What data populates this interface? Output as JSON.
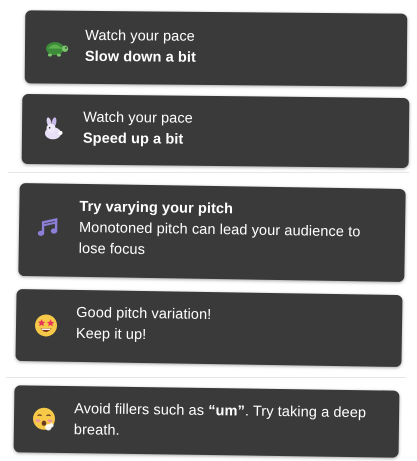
{
  "notifications": [
    {
      "icon": "turtle-icon",
      "title": "Watch your pace",
      "message": "Slow down a bit"
    },
    {
      "icon": "rabbit-icon",
      "title": "Watch your pace",
      "message": "Speed up a bit"
    },
    {
      "icon": "music-notes-icon",
      "title": "Try varying your pitch",
      "message_line1": "Monotoned pitch can lead your audience to",
      "message_line2": "lose focus"
    },
    {
      "icon": "star-struck-face-icon",
      "message_line1": "Good pitch variation!",
      "message_line2": "Keep it up!"
    },
    {
      "icon": "fainting-face-icon",
      "message_prefix": "Avoid fillers such as ",
      "filler_word": "“um”",
      "message_suffix": ". Try taking a deep",
      "message_line2": "breath."
    }
  ],
  "colors": {
    "card_background": "#3a3a3b",
    "text": "#ffffff",
    "page_background": "#ffffff"
  }
}
